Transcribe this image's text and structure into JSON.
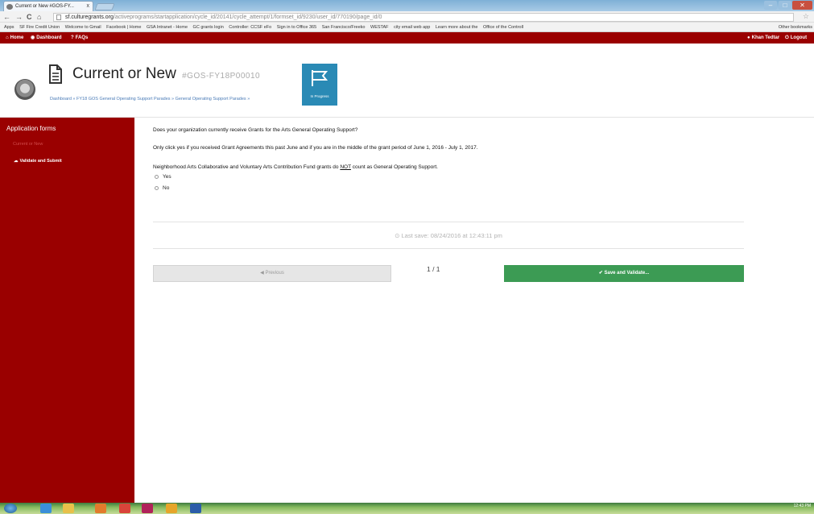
{
  "browser": {
    "tab_title": "Current or New #GOS-FY...",
    "tab_close": "x",
    "url_host": "sf.culturegrants.org",
    "url_path": "/activeprograms/startapplication/cycle_id/20141/cycle_attempt/1/formset_id/9230/user_id/770190/page_id/0",
    "back": "←",
    "forward": "→",
    "reload": "C",
    "home": "⌂",
    "star": "☆",
    "bookmarks": [
      "Apps",
      "SF Fire Credit Union",
      "Welcome to Gmail",
      "Facebook | Home",
      "GSA Intranet - Home",
      "GC grants login",
      "Controller: CCSF eFo",
      "Sign in to Office 365",
      "San Francisco/Freeko",
      "WESTAF",
      "city email web app",
      "Learn more about the",
      "Office of the Controll"
    ],
    "other_bookmarks": "Other bookmarks"
  },
  "appnav": {
    "home": "Home",
    "dashboard": "Dashboard",
    "faqs": "FAQs",
    "user": "Khan Tedtar",
    "logout": "Logout"
  },
  "header": {
    "title": "Current or New",
    "code": "#GOS-FY18P00010",
    "breadcrumb": "Dashboard » FY18 GOS General Operating Support Parades » General Operating Support Parades »",
    "status": "In Progress"
  },
  "sidebar": {
    "heading": "Application forms",
    "item_forms": "Current or New",
    "item_validate": "Validate and Submit"
  },
  "form": {
    "question": "Does your organization currently receive Grants for the Arts General Operating Support?",
    "note_1": "Only click yes if you received Grant Agreements this past June and if you are in the middle of the grant period of June 1, 2016 - July 1, 2017.",
    "note_2_a": "Neighborhood Arts Collaborative and Voluntary Arts Contribution Fund grants do ",
    "note_2_not": "NOT",
    "note_2_b": " count as General Operating Support.",
    "options": [
      "Yes",
      "No"
    ],
    "last_save": "Last save: 08/24/2016 at 12:43:11 pm",
    "prev_label": "Previous",
    "pager": "1 / 1",
    "save_label": "Save and Validate..."
  },
  "taskbar": {
    "time": "12:43 PM"
  },
  "colors": {
    "brand_red": "#9a0000",
    "save_green": "#3c9b54",
    "status_blue": "#2a8ab5"
  }
}
